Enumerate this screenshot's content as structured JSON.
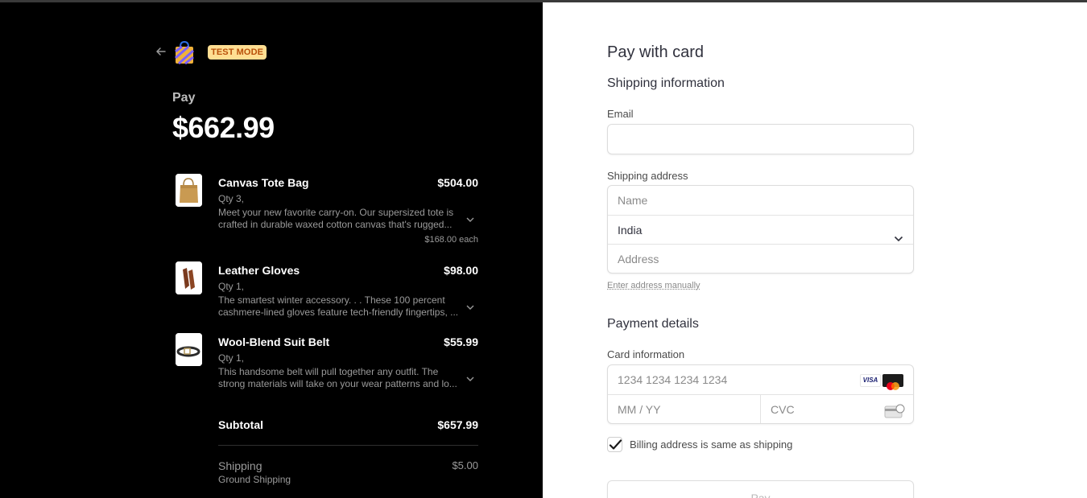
{
  "header": {
    "test_mode_badge": "TEST MODE",
    "logo_icon": "shopping-bag-icon",
    "back_icon": "arrow-left-icon"
  },
  "summary": {
    "pay_label": "Pay",
    "total": "$662.99",
    "items": [
      {
        "name": "Canvas Tote Bag",
        "price": "$504.00",
        "qty": "Qty 3,",
        "description": "Meet your new favorite carry-on. Our supersized tote is crafted in durable waxed cotton canvas that's rugged...",
        "each": "$168.00 each"
      },
      {
        "name": "Leather Gloves",
        "price": "$98.00",
        "qty": "Qty 1,",
        "description": "The smartest winter accessory. . . These 100 percent cashmere-lined gloves feature tech-friendly fingertips, ..."
      },
      {
        "name": "Wool-Blend Suit Belt",
        "price": "$55.99",
        "qty": "Qty 1,",
        "description": "This handsome belt will pull together any outfit. The strong materials will take on your wear patterns and lo..."
      }
    ],
    "subtotal_label": "Subtotal",
    "subtotal_value": "$657.99",
    "shipping_label": "Shipping",
    "shipping_method": "Ground Shipping",
    "shipping_value": "$5.00"
  },
  "form": {
    "title": "Pay with card",
    "shipping_heading": "Shipping information",
    "email_label": "Email",
    "email_value": "",
    "shipping_address_label": "Shipping address",
    "name_placeholder": "Name",
    "country_value": "India",
    "address_placeholder": "Address",
    "enter_manually_link": "Enter address manually",
    "payment_heading": "Payment details",
    "card_info_label": "Card information",
    "card_number_placeholder": "1234 1234 1234 1234",
    "expiry_placeholder": "MM / YY",
    "cvc_placeholder": "CVC",
    "card_brands": [
      "VISA",
      "mastercard"
    ],
    "billing_same_label": "Billing address is same as shipping",
    "billing_same_checked": true,
    "pay_button_label": "Pay"
  },
  "colors": {
    "left_bg": "#000000",
    "right_bg": "#ffffff",
    "badge_bg": "#ffde92",
    "badge_text": "#b8500a"
  }
}
